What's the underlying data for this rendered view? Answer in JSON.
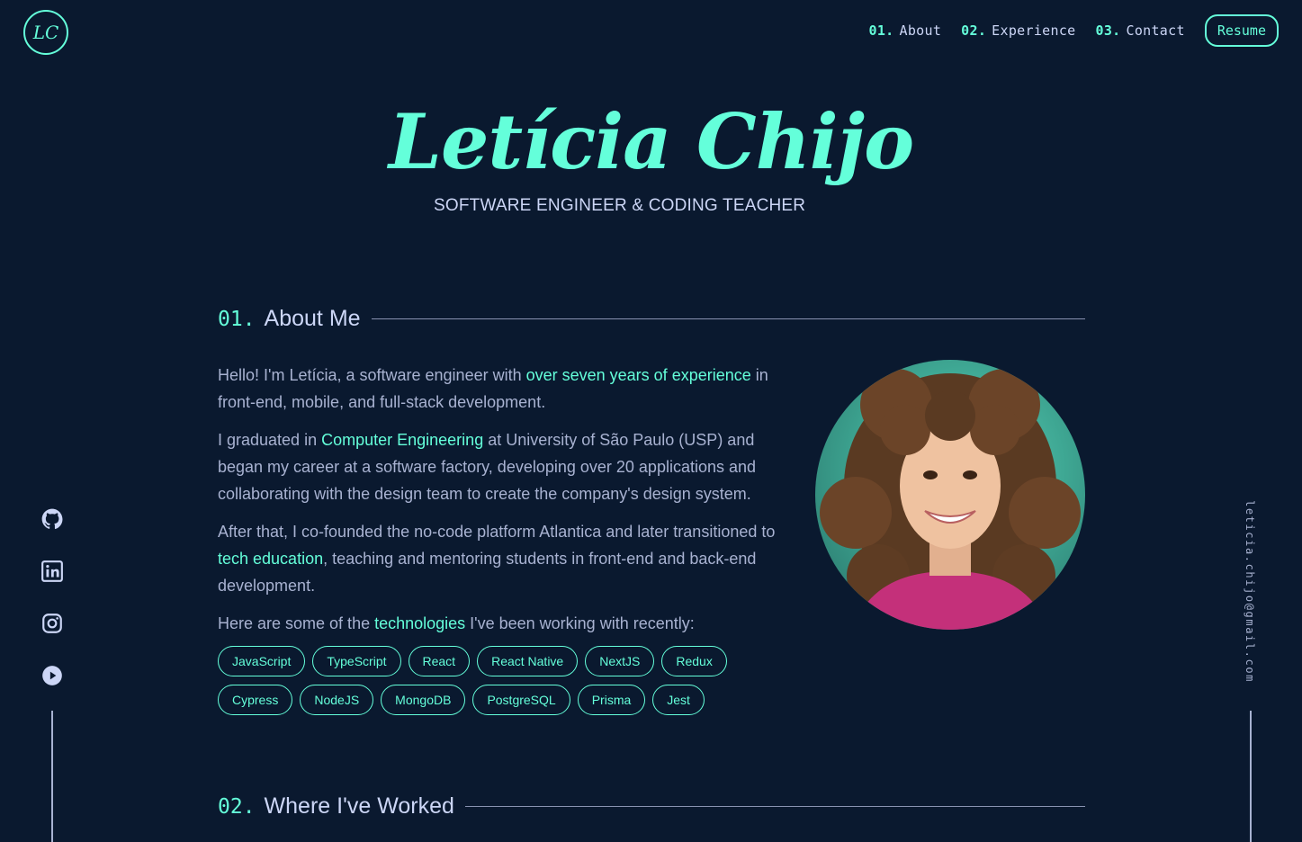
{
  "logo": {
    "text": "LC"
  },
  "nav": {
    "items": [
      {
        "num": "01.",
        "label": "About"
      },
      {
        "num": "02.",
        "label": "Experience"
      },
      {
        "num": "03.",
        "label": "Contact"
      }
    ],
    "resume_label": "Resume"
  },
  "hero": {
    "name": "Letícia Chijo",
    "subtitle": "SOFTWARE ENGINEER & CODING TEACHER"
  },
  "about": {
    "num": "01.",
    "title": "About Me",
    "p1_a": "Hello! I'm Letícia, a software engineer with ",
    "p1_hl": "over seven years of experience",
    "p1_b": " in front-end, mobile, and full-stack development.",
    "p2_a": "I graduated in ",
    "p2_hl": "Computer Engineering",
    "p2_b": " at University of São Paulo (USP) and began my career at a software factory, developing over 20 applications and collaborating with the design team to create the company's design system.",
    "p3_a": "After that, I co-founded the no-code platform Atlantica and later transitioned to ",
    "p3_hl": "tech education",
    "p3_b": ", teaching and mentoring students in front-end and back-end development.",
    "p4_a": "Here are some of the ",
    "p4_hl": "technologies",
    "p4_b": " I've been working with recently:",
    "technologies": [
      "JavaScript",
      "TypeScript",
      "React",
      "React Native",
      "NextJS",
      "Redux",
      "Cypress",
      "NodeJS",
      "MongoDB",
      "PostgreSQL",
      "Prisma",
      "Jest"
    ]
  },
  "experience": {
    "num": "02.",
    "title": "Where I've Worked"
  },
  "socials": [
    "github-icon",
    "linkedin-icon",
    "instagram-icon",
    "youtube-icon"
  ],
  "email": "leticia.chijo@gmail.com",
  "colors": {
    "background": "#0a192f",
    "accent": "#64ffda",
    "text": "#a8b2d1",
    "heading": "#ccd6f6"
  }
}
